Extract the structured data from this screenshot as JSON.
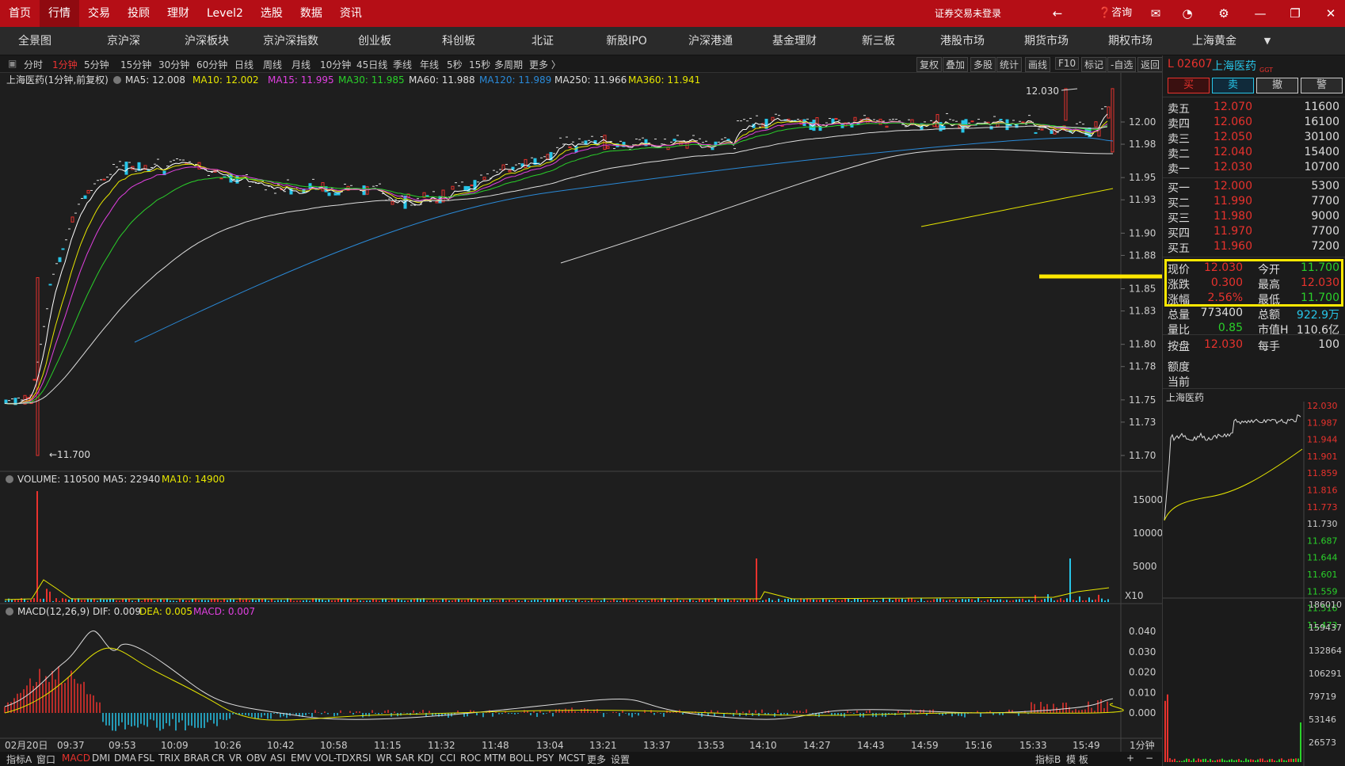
{
  "topmenu": [
    "首页",
    "行情",
    "交易",
    "投顾",
    "理财",
    "Level2",
    "选股",
    "数据",
    "资讯"
  ],
  "topbar": {
    "login_status": "证券交易未登录",
    "consult": "咨询"
  },
  "subnav": [
    "全景图",
    "京沪深",
    "沪深板块",
    "京沪深指数",
    "创业板",
    "科创板",
    "北证",
    "新股IPO",
    "沪深港通",
    "基金理财",
    "新三板",
    "港股市场",
    "期货市场",
    "期权市场",
    "上海黄金"
  ],
  "periods": [
    "分时",
    "1分钟",
    "5分钟",
    "15分钟",
    "30分钟",
    "60分钟",
    "日线",
    "周线",
    "月线",
    "10分钟",
    "45日线",
    "季线",
    "年线",
    "5秒",
    "15秒",
    "多周期",
    "更多 〉"
  ],
  "toolbar_right": [
    "复权",
    "叠加",
    "多股",
    "统计",
    "画线",
    "F10",
    "标记",
    "-自选",
    "返回"
  ],
  "chart_info": {
    "name": "上海医药(1分钟,前复权)",
    "ma5": "MA5: 12.008",
    "ma10": "MA10: 12.002",
    "ma15": "MA15: 11.995",
    "ma30": "MA30: 11.985",
    "ma60": "MA60: 11.988",
    "ma120": "MA120: 11.989",
    "ma250": "MA250: 11.966",
    "ma360": "MA360: 11.941",
    "high_marker": "12.030",
    "low_marker": "11.700"
  },
  "price_axis": [
    "12.00",
    "11.98",
    "11.95",
    "11.93",
    "11.90",
    "11.88",
    "11.85",
    "11.83",
    "11.80",
    "11.78",
    "11.75",
    "11.73",
    "11.70"
  ],
  "volume_info": {
    "label": "VOLUME: 110500",
    "ma5": "MA5: 22940",
    "ma10": "MA10: 14900"
  },
  "volume_axis": [
    "15000",
    "10000",
    "5000"
  ],
  "volume_unit": "X10",
  "macd_info": {
    "label": "MACD(12,26,9)",
    "dif": "DIF: 0.009",
    "dea": "DEA: 0.005",
    "macd": "MACD: 0.007"
  },
  "macd_axis": [
    "0.040",
    "0.030",
    "0.020",
    "0.010",
    "0.000"
  ],
  "time_axis": [
    "02月20日",
    "09:37",
    "09:53",
    "10:09",
    "10:26",
    "10:42",
    "10:58",
    "11:15",
    "11:32",
    "11:48",
    "13:04",
    "13:21",
    "13:37",
    "13:53",
    "14:10",
    "14:27",
    "14:43",
    "14:59",
    "15:16",
    "15:33",
    "15:49"
  ],
  "period_label": "1分钟",
  "indicators": [
    "指标A",
    "窗口",
    "MACD",
    "DMI",
    "DMA",
    "FSL",
    "TRIX",
    "BRAR",
    "CR",
    "VR",
    "OBV",
    "ASI",
    "EMV",
    "VOL-TDX",
    "RSI",
    "WR",
    "SAR",
    "KDJ",
    "CCI",
    "ROC",
    "MTM",
    "BOLL",
    "PSY",
    "MCST",
    "更多",
    "设置"
  ],
  "bottom_right": [
    "指标B",
    "模 板"
  ],
  "quote": {
    "flag": "L",
    "code": "02607",
    "name": "上海医药",
    "tag": "GGT",
    "buttons": [
      "买",
      "卖",
      "撤",
      "警"
    ],
    "sell": [
      {
        "label": "卖五",
        "price": "12.070",
        "vol": "11600"
      },
      {
        "label": "卖四",
        "price": "12.060",
        "vol": "16100"
      },
      {
        "label": "卖三",
        "price": "12.050",
        "vol": "30100"
      },
      {
        "label": "卖二",
        "price": "12.040",
        "vol": "15400"
      },
      {
        "label": "卖一",
        "price": "12.030",
        "vol": "10700"
      }
    ],
    "buy": [
      {
        "label": "买一",
        "price": "12.000",
        "vol": "5300"
      },
      {
        "label": "买二",
        "price": "11.990",
        "vol": "7700"
      },
      {
        "label": "买三",
        "price": "11.980",
        "vol": "9000"
      },
      {
        "label": "买四",
        "price": "11.970",
        "vol": "7700"
      },
      {
        "label": "买五",
        "price": "11.960",
        "vol": "7200"
      }
    ],
    "stats": [
      [
        "现价",
        "12.030",
        "今开",
        "11.700"
      ],
      [
        "涨跌",
        "0.300",
        "最高",
        "12.030"
      ],
      [
        "涨幅",
        "2.56%",
        "最低",
        "11.700"
      ],
      [
        "总量",
        "773400",
        "总额",
        "922.9万"
      ],
      [
        "量比",
        "0.85",
        "市值H",
        "110.6亿"
      ],
      [
        "按盘",
        "12.030",
        "每手",
        "100"
      ]
    ],
    "extra": [
      "额度",
      "当前"
    ]
  },
  "mini": {
    "title": "上海医药",
    "price_axis": [
      "12.030",
      "11.987",
      "11.944",
      "11.901",
      "11.859",
      "11.816",
      "11.773",
      "11.730",
      "11.687",
      "11.644",
      "11.601",
      "11.559",
      "11.516",
      "11.473"
    ],
    "vol_axis": [
      "186010",
      "159437",
      "132864",
      "106291",
      "79719",
      "53146",
      "26573"
    ]
  },
  "colors": {
    "up": "#e8322d",
    "down": "#27c5e8",
    "highlight": "#ffe800",
    "brand": "#b50e16"
  }
}
